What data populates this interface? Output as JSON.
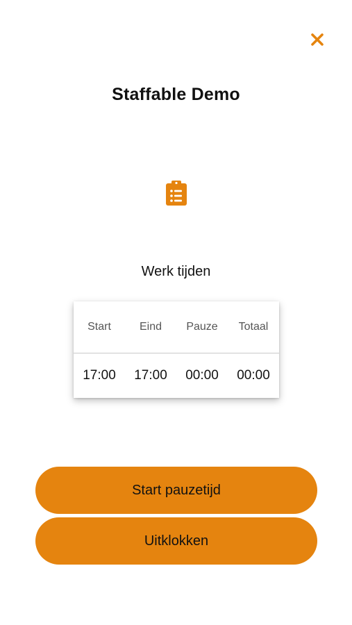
{
  "header": {
    "title": "Staffable Demo"
  },
  "section": {
    "label": "Werk tijden"
  },
  "times_table": {
    "columns": [
      "Start",
      "Eind",
      "Pauze",
      "Totaal"
    ],
    "values": [
      "17:00",
      "17:00",
      "00:00",
      "00:00"
    ]
  },
  "actions": {
    "start_pause_label": "Start pauzetijd",
    "clock_out_label": "Uitklokken"
  },
  "icons": {
    "close": "close-icon",
    "clipboard": "clipboard-list-icon"
  },
  "colors": {
    "accent": "#e5840f",
    "text": "#111111",
    "header_text": "#555555"
  }
}
